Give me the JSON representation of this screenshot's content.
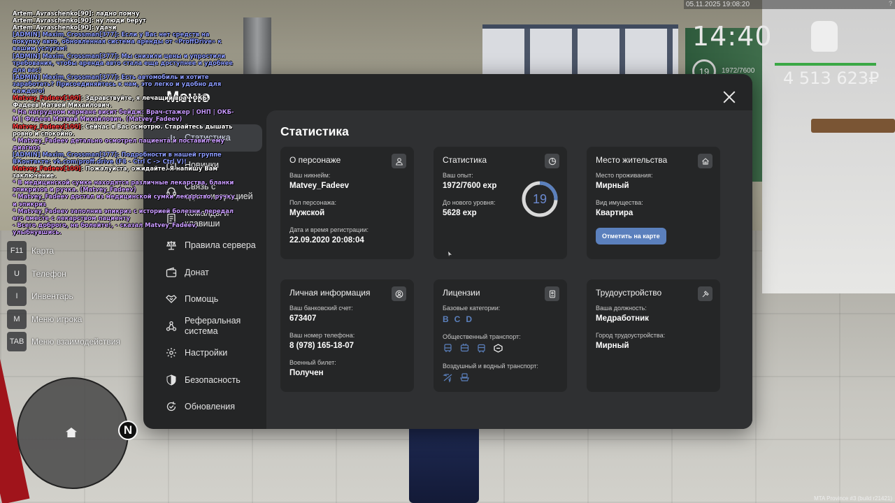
{
  "hud": {
    "date": "05.11.2025 19:08:20",
    "corner_mark": "?",
    "time": "14:40",
    "level": "19",
    "exp": "1972/7600",
    "money": "4 513 623₽",
    "watermark": "MTA Province #3 (build r21421)"
  },
  "chat": [
    {
      "cls": "white",
      "text": "Artem_Avraschenko[90]: ладно помчу"
    },
    {
      "cls": "white",
      "text": "Artem_Avraschenko[90]: ну люди берут"
    },
    {
      "cls": "white",
      "text": "Artem_Avraschenko[90]: удачи"
    },
    {
      "cls": "admin",
      "text": "[ADMIN] Maxim_Crossman[377]: Если у Вас нет средств на покупку авто, обновленная система аренды от «ProffDrive» к вашим услугам!"
    },
    {
      "cls": "admin",
      "text": "[ADMIN] Maxim_Crossman[377]: Мы снизили цены и упростили требования, чтобы аренда авто стала еще доступнее и удобнее для вас!"
    },
    {
      "cls": "admin",
      "text": "[ADMIN] Maxim_Crossman[377]: Есть автомобиль и хотите заработать? Присоединяйтесь к нам, это легко и удобно для каждого!"
    },
    {
      "cls": "say",
      "name": "Matvey_Fadeev[100]",
      "text": ": Здравствуйте, я лечащий врач ОКБ, Фадеев Матвей Михайлович."
    },
    {
      "cls": "me",
      "text": "* На нагрудном кармане висит бейдж: Врач-стажер | ОНП | ОКБ-М | Фадеев Матвей Михайлович. (Matvey_Fadeev)"
    },
    {
      "cls": "say",
      "name": "Matvey_Fadeev[100]",
      "text": ": Сейчас я Вас осмотрю. Старайтесь дышать ровно и спокойно."
    },
    {
      "cls": "me",
      "text": "* Matvey_Fadeev детально осмотрел пациента и поставил ему диагноз"
    },
    {
      "cls": "admin",
      "text": "[ADMIN] Maxim_Crossman[377]: Подробности в нашей группе ВКонтакте: vk.com/proff.drive (F8 - Ctrl C -> Ctrl V)!"
    },
    {
      "cls": "say",
      "name": "Matvey_Fadeev[100]",
      "text": ": Пожалуйста, ожидайте. Я напишу Вам заключение."
    },
    {
      "cls": "me",
      "text": "* В медицинской сумке находятся различные лекарства, бланки эпикризов и ручка. (Matvey_Fadeev)"
    },
    {
      "cls": "me",
      "text": "* Matvey_Fadeev достал из медицинской сумки лекарство, ручку и эпикриз"
    },
    {
      "cls": "me",
      "text": "* Matvey_Fadeev заполнив эпикриз с историей болезни, передал его вместе с лекарством пациенту"
    },
    {
      "cls": "me",
      "text": "- Всего доброго, не болейте!, - сказал Matvey_Fadeev, улыбнувшись."
    }
  ],
  "hotkeys": [
    {
      "key": "F11",
      "label": "Карта"
    },
    {
      "key": "U",
      "label": "Телефон"
    },
    {
      "key": "I",
      "label": "Инвентарь"
    },
    {
      "key": "M",
      "label": "Меню игрока"
    },
    {
      "key": "TAB",
      "label": "Меню взаимодействия"
    }
  ],
  "menu": {
    "title": "Меню",
    "nav": [
      {
        "label": "Статистика",
        "icon": "chart-icon",
        "active": true
      },
      {
        "label": "Новинки",
        "icon": "gift-icon",
        "active": false
      },
      {
        "label": "Связь с администрацией",
        "icon": "headset-icon",
        "active": false
      },
      {
        "label": "Команды и клавиши",
        "icon": "document-icon",
        "active": false
      },
      {
        "label": "Правила сервера",
        "icon": "scales-icon",
        "active": false
      },
      {
        "label": "Донат",
        "icon": "wallet-icon",
        "active": false
      },
      {
        "label": "Помощь",
        "icon": "handshake-icon",
        "active": false
      },
      {
        "label": "Реферальная система",
        "icon": "network-icon",
        "active": false
      },
      {
        "label": "Настройки",
        "icon": "gear-icon",
        "active": false
      },
      {
        "label": "Безопасность",
        "icon": "shield-icon",
        "active": false
      },
      {
        "label": "Обновления",
        "icon": "refresh-icon",
        "active": false
      }
    ],
    "content_title": "Статистика",
    "cards": {
      "character": {
        "title": "О персонаже",
        "nick_label": "Ваш никнейм:",
        "nick": "Matvey_Fadeev",
        "gender_label": "Пол персонажа:",
        "gender": "Мужской",
        "reg_label": "Дата и время регистрации:",
        "reg": "22.09.2020 20:08:04"
      },
      "stats": {
        "title": "Статистика",
        "exp_label": "Ваш опыт:",
        "exp": "1972/7600 exp",
        "next_label": "До нового уровня:",
        "next": "5628 exp",
        "level": "19",
        "progress": 0.26
      },
      "residence": {
        "title": "Место жительства",
        "place_label": "Место проживания:",
        "place": "Мирный",
        "property_label": "Вид имущества:",
        "property": "Квартира",
        "button": "Отметить на карте"
      },
      "personal": {
        "title": "Личная информация",
        "bank_label": "Ваш банковский счет:",
        "bank": "673407",
        "phone_label": "Ваш номер телефона:",
        "phone": "8 (978) 165-18-07",
        "military_label": "Военный билет:",
        "military": "Получен"
      },
      "licenses": {
        "title": "Лицензии",
        "base_label": "Базовые категории:",
        "categories": [
          "B",
          "C",
          "D"
        ],
        "public_label": "Общественный транспорт:",
        "air_label": "Воздушный и водный транспорт:"
      },
      "employment": {
        "title": "Трудоустройство",
        "position_label": "Ваша должность:",
        "position": "Медработник",
        "city_label": "Город трудоустройства:",
        "city": "Мирный"
      }
    }
  },
  "colors": {
    "accent": "#5b80bd",
    "ring_track": "#d9d9d9",
    "panel": "#242526",
    "content": "#2f3032",
    "card": "#252627"
  }
}
